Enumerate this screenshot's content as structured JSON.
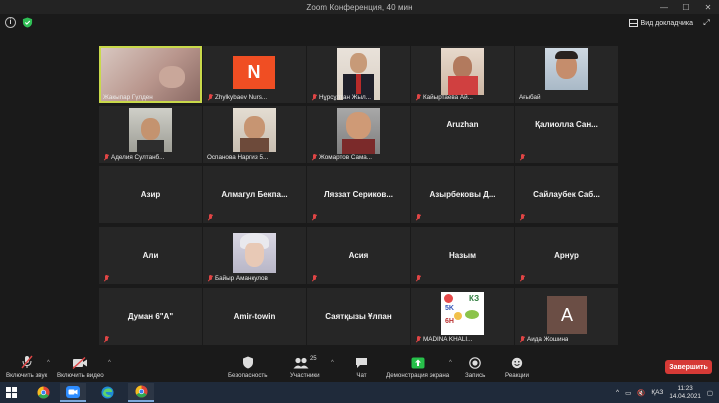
{
  "window": {
    "title": "Zoom Конференция, 40 мин",
    "controls": [
      "—",
      "☐",
      "✕"
    ]
  },
  "topbar": {
    "view_label": "Вид докладчика",
    "fullscreen_glyph": "⤢"
  },
  "participants": [
    {
      "name": "Жакыпар Гүлден",
      "muted": false,
      "video": true
    },
    {
      "name": "Zhylkybaev Nurs...",
      "muted": true,
      "avatar_letter": "N",
      "avatar_color": "#f04e23"
    },
    {
      "name": "Нұрсұлтан Жыл...",
      "muted": true,
      "video": true
    },
    {
      "name": "Кайыртаева Ай...",
      "muted": true,
      "video": true
    },
    {
      "name": "Ағыбай",
      "muted": false,
      "video": true
    },
    {
      "name": "Аделия Султанб...",
      "muted": true,
      "video": true
    },
    {
      "name": "Оспанова Наргиз 5...",
      "muted": false,
      "video": true
    },
    {
      "name": "Жомартов Сама...",
      "muted": true,
      "video": true
    },
    {
      "name": "Aruzhan",
      "muted": false
    },
    {
      "name": "Қалиолла Сан...",
      "muted": true
    },
    {
      "name": "Азир",
      "muted": false
    },
    {
      "name": "Алмагул Бекпа...",
      "muted": true
    },
    {
      "name": "Ляззат Сериков...",
      "muted": true
    },
    {
      "name": "Азырбековы Д...",
      "muted": true
    },
    {
      "name": "Сайлаубек Саб...",
      "muted": true
    },
    {
      "name": "Али",
      "muted": true
    },
    {
      "name": "Байыр Аманкулов",
      "muted": true,
      "video": true
    },
    {
      "name": "Асия",
      "muted": true
    },
    {
      "name": "Назым",
      "muted": true
    },
    {
      "name": "Арнур",
      "muted": true
    },
    {
      "name": "Думан 6\"А\"",
      "muted": true
    },
    {
      "name": "Amir-towin",
      "muted": false
    },
    {
      "name": "Саятқызы Ұлпан",
      "muted": false
    },
    {
      "name": "MADINA KHALI...",
      "muted": true,
      "video": true
    },
    {
      "name": "Аида Жошина",
      "muted": true,
      "avatar_letter": "A",
      "avatar_color": "#6b4e45"
    }
  ],
  "card_text": {
    "top": "КЗ",
    "mid": "5K",
    "bottom": "6H"
  },
  "toolbar": {
    "audio_label": "Включить звук",
    "video_label": "Включить видео",
    "security_label": "Безопасность",
    "participants_label": "Участники",
    "participants_count": "25",
    "chat_label": "Чат",
    "share_label": "Демонстрация экрана",
    "record_label": "Запись",
    "reactions_label": "Реакции",
    "end_label": "Завершить",
    "share_color": "#27c04a",
    "end_color": "#d63a36"
  },
  "taskbar": {
    "language": "ҚАЗ",
    "time": "11:23",
    "date": "14.04.2021",
    "icons": [
      "windows-start-icon",
      "chrome-icon",
      "zoom-icon",
      "edge-icon",
      "chrome-profile-icon"
    ]
  }
}
